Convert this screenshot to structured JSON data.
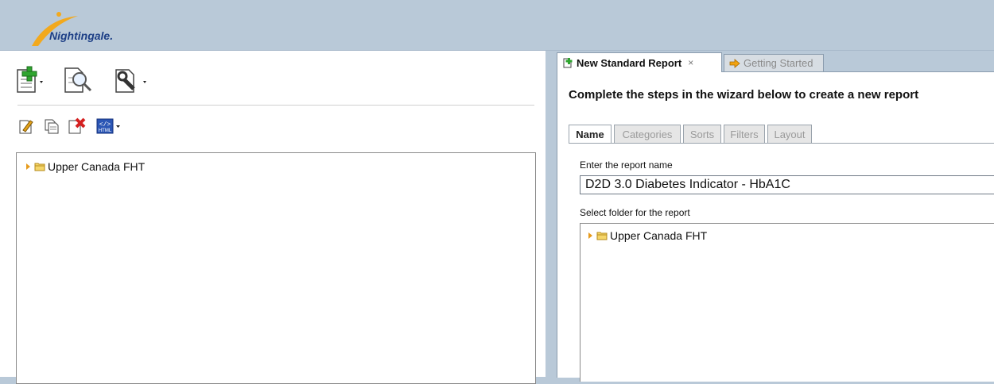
{
  "app": {
    "logo_text": "Nightingale",
    "logo_dot": "."
  },
  "toolbar": {
    "row1": [
      {
        "icon": "new-report-icon",
        "has_dropdown": true
      },
      {
        "icon": "preview-report-icon",
        "has_dropdown": false
      },
      {
        "icon": "tools-icon",
        "has_dropdown": true
      }
    ],
    "row2": [
      {
        "icon": "edit-icon"
      },
      {
        "icon": "copy-icon"
      },
      {
        "icon": "delete-icon"
      },
      {
        "icon": "html-export-icon",
        "has_dropdown": true
      }
    ]
  },
  "left_tree": {
    "root": "Upper Canada FHT"
  },
  "doc_tabs": [
    {
      "label": "New Standard Report",
      "active": true,
      "close": "×"
    },
    {
      "label": "Getting Started",
      "active": false
    }
  ],
  "wizard": {
    "title": "Complete the steps in the wizard below to create a new report",
    "tabs": [
      "Name",
      "Categories",
      "Sorts",
      "Filters",
      "Layout"
    ],
    "active_tab": "Name",
    "name_label": "Enter the report name",
    "name_value": "D2D 3.0 Diabetes Indicator - HbA1C",
    "folder_label": "Select folder for the report",
    "folder_root": "Upper Canada FHT"
  },
  "colors": {
    "header_bg": "#b9c9d8",
    "logo_blue": "#1d3f86",
    "folder_orange": "#e79b1c"
  }
}
